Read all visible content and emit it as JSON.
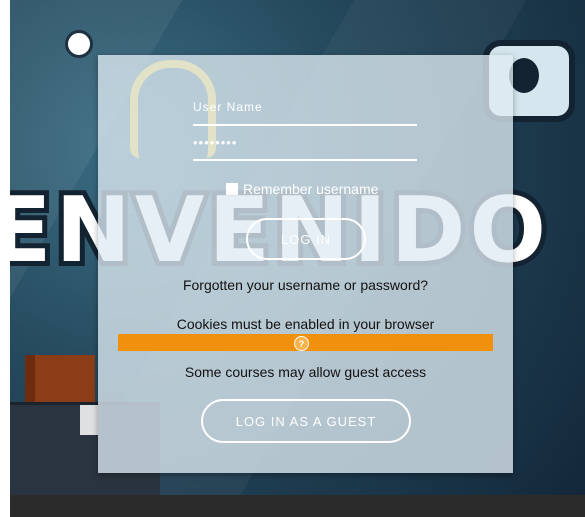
{
  "login_form": {
    "username_label": "User Name",
    "password_value": "••••••••",
    "remember_label": "Remember username",
    "login_button": "LOG IN",
    "forgot_link": "Forgotten your username or password?"
  },
  "cookies": {
    "notice": "Cookies must be enabled in your browser",
    "help_icon": "?"
  },
  "guest": {
    "notice": "Some courses may allow guest access",
    "button": "LOG IN AS A GUEST"
  },
  "background": {
    "banner_text": "ENVENIDO"
  },
  "colors": {
    "accent": "#f1900d",
    "footer": "#2b2b2b"
  }
}
